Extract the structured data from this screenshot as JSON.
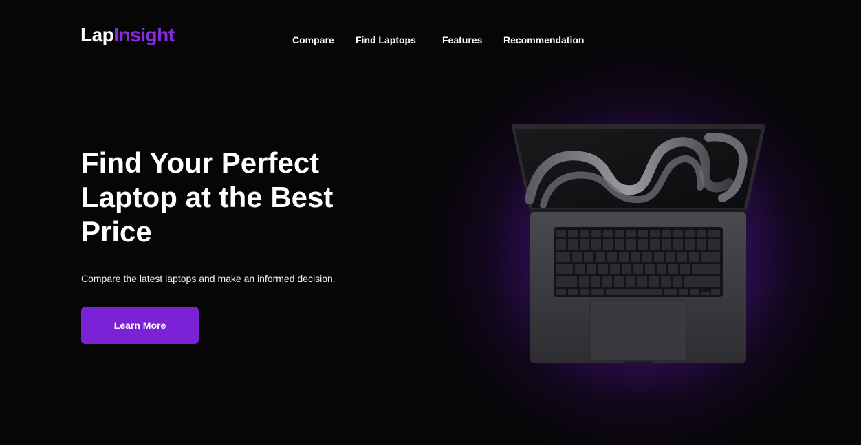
{
  "brand": {
    "part1": "Lap",
    "part2": "Insight",
    "accent_color": "#8a2be2"
  },
  "nav": {
    "items": [
      {
        "label": "Compare"
      },
      {
        "label": "Find Laptops"
      },
      {
        "label": "Features"
      },
      {
        "label": "Recommendation"
      }
    ]
  },
  "hero": {
    "title": "Find Your Perfect Laptop at the Best Price",
    "subtitle": "Compare the latest laptops and make an informed decision.",
    "cta_label": "Learn More",
    "cta_color": "#7b22d6",
    "image": "laptop-image"
  }
}
